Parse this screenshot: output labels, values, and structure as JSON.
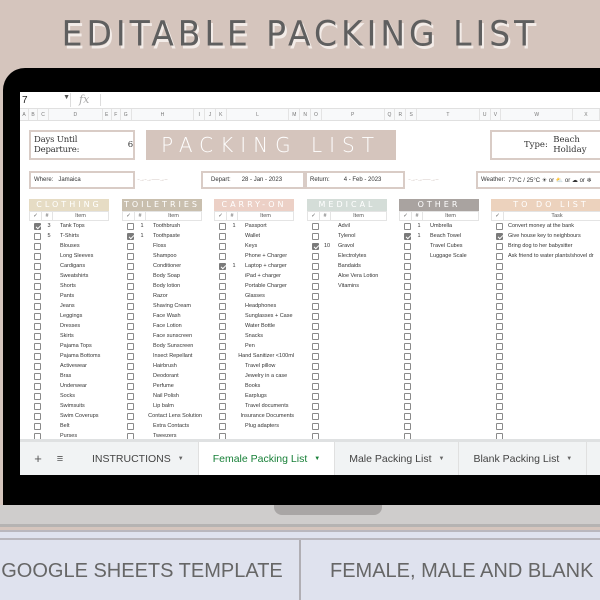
{
  "headline": "EDITABLE PACKING LIST",
  "formula_bar": {
    "cell_ref": "7",
    "fx_label": "fx"
  },
  "column_headers": [
    "A",
    "B",
    "C",
    "D",
    "E",
    "F",
    "G",
    "H",
    "I",
    "J",
    "K",
    "L",
    "M",
    "N",
    "O",
    "P",
    "Q",
    "R",
    "S",
    "T",
    "U",
    "V",
    "W",
    "X"
  ],
  "sheet": {
    "days_label": "Days Until Departure:",
    "days_value": "6",
    "title": "PACKING LIST",
    "type_label": "Type:",
    "type_value": "Beach Holiday",
    "where_label": "Where:",
    "where_value": "Jamaica",
    "depart_label": "Depart:",
    "depart_value": "28 - Jan - 2023",
    "return_label": "Return:",
    "return_value": "4 - Feb - 2023",
    "weather_label": "Weather:",
    "weather_value": "77°C / 25°C ☀ or ⛅ or ☁ or ❄",
    "arrow_decor": "··→··→········→···"
  },
  "categories": [
    {
      "name": "CLOTHING",
      "color": "#e6dcc4",
      "check_header": "✓",
      "qty_header": "#",
      "item_header": "Item",
      "items": [
        {
          "checked": true,
          "qty": "3",
          "item": "Tank Tops"
        },
        {
          "checked": false,
          "qty": "5",
          "item": "T-Shirts"
        },
        {
          "checked": false,
          "qty": "",
          "item": "Blouses"
        },
        {
          "checked": false,
          "qty": "",
          "item": "Long Sleeves"
        },
        {
          "checked": false,
          "qty": "",
          "item": "Cardigans"
        },
        {
          "checked": false,
          "qty": "",
          "item": "Sweatshirts"
        },
        {
          "checked": false,
          "qty": "",
          "item": "Shorts"
        },
        {
          "checked": false,
          "qty": "",
          "item": "Pants"
        },
        {
          "checked": false,
          "qty": "",
          "item": "Jeans"
        },
        {
          "checked": false,
          "qty": "",
          "item": "Leggings"
        },
        {
          "checked": false,
          "qty": "",
          "item": "Dresses"
        },
        {
          "checked": false,
          "qty": "",
          "item": "Skirts"
        },
        {
          "checked": false,
          "qty": "",
          "item": "Pajama Tops"
        },
        {
          "checked": false,
          "qty": "",
          "item": "Pajama Bottoms"
        },
        {
          "checked": false,
          "qty": "",
          "item": "Activewear"
        },
        {
          "checked": false,
          "qty": "",
          "item": "Bras"
        },
        {
          "checked": false,
          "qty": "",
          "item": "Underwear"
        },
        {
          "checked": false,
          "qty": "",
          "item": "Socks"
        },
        {
          "checked": false,
          "qty": "",
          "item": "Swimsuits"
        },
        {
          "checked": false,
          "qty": "",
          "item": "Swim Coverups"
        },
        {
          "checked": false,
          "qty": "",
          "item": "Belt"
        },
        {
          "checked": false,
          "qty": "",
          "item": "Purses"
        }
      ]
    },
    {
      "name": "TOILETRIES",
      "color": "#c9bfae",
      "check_header": "✓",
      "qty_header": "#",
      "item_header": "Item",
      "items": [
        {
          "checked": false,
          "qty": "1",
          "item": "Toothbrush"
        },
        {
          "checked": true,
          "qty": "1",
          "item": "Toothpaste"
        },
        {
          "checked": false,
          "qty": "",
          "item": "Floss"
        },
        {
          "checked": false,
          "qty": "",
          "item": "Shampoo"
        },
        {
          "checked": false,
          "qty": "",
          "item": "Conditioner"
        },
        {
          "checked": false,
          "qty": "",
          "item": "Body Soap"
        },
        {
          "checked": false,
          "qty": "",
          "item": "Body lotion"
        },
        {
          "checked": false,
          "qty": "",
          "item": "Razor"
        },
        {
          "checked": false,
          "qty": "",
          "item": "Shaving Cream"
        },
        {
          "checked": false,
          "qty": "",
          "item": "Face Wash"
        },
        {
          "checked": false,
          "qty": "",
          "item": "Face Lotion"
        },
        {
          "checked": false,
          "qty": "",
          "item": "Face sunscreen"
        },
        {
          "checked": false,
          "qty": "",
          "item": "Body Sunscreen"
        },
        {
          "checked": false,
          "qty": "",
          "item": "Insect Repellant"
        },
        {
          "checked": false,
          "qty": "",
          "item": "Hairbrush"
        },
        {
          "checked": false,
          "qty": "",
          "item": "Deodorant"
        },
        {
          "checked": false,
          "qty": "",
          "item": "Perfume"
        },
        {
          "checked": false,
          "qty": "",
          "item": "Nail Polish"
        },
        {
          "checked": false,
          "qty": "",
          "item": "Lip balm"
        },
        {
          "checked": false,
          "qty": "",
          "item": "Contact Lens Solution"
        },
        {
          "checked": false,
          "qty": "",
          "item": "Extra Contacts"
        },
        {
          "checked": false,
          "qty": "",
          "item": "Tweezers"
        }
      ]
    },
    {
      "name": "CARRY-ON",
      "color": "#ecd0c6",
      "check_header": "✓",
      "qty_header": "#",
      "item_header": "Item",
      "items": [
        {
          "checked": false,
          "qty": "1",
          "item": "Passport"
        },
        {
          "checked": false,
          "qty": "",
          "item": "Wallet"
        },
        {
          "checked": false,
          "qty": "",
          "item": "Keys"
        },
        {
          "checked": false,
          "qty": "",
          "item": "Phone + Charger"
        },
        {
          "checked": true,
          "qty": "1",
          "item": "Laptop + charger"
        },
        {
          "checked": false,
          "qty": "",
          "item": "iPad + charger"
        },
        {
          "checked": false,
          "qty": "",
          "item": "Portable Charger"
        },
        {
          "checked": false,
          "qty": "",
          "item": "Glasses"
        },
        {
          "checked": false,
          "qty": "",
          "item": "Headphones"
        },
        {
          "checked": false,
          "qty": "",
          "item": "Sunglasses + Case"
        },
        {
          "checked": false,
          "qty": "",
          "item": "Water Bottle"
        },
        {
          "checked": false,
          "qty": "",
          "item": "Snacks"
        },
        {
          "checked": false,
          "qty": "",
          "item": "Pen"
        },
        {
          "checked": false,
          "qty": "",
          "item": "Hand Sanitizer <100ml"
        },
        {
          "checked": false,
          "qty": "",
          "item": "Travel pillow"
        },
        {
          "checked": false,
          "qty": "",
          "item": "Jewelry in a case"
        },
        {
          "checked": false,
          "qty": "",
          "item": "Books"
        },
        {
          "checked": false,
          "qty": "",
          "item": "Earplugs"
        },
        {
          "checked": false,
          "qty": "",
          "item": "Travel documents"
        },
        {
          "checked": false,
          "qty": "",
          "item": "Insurance Documents"
        },
        {
          "checked": false,
          "qty": "",
          "item": "Plug adapters"
        },
        {
          "checked": false,
          "qty": "",
          "item": ""
        }
      ]
    },
    {
      "name": "MEDICAL",
      "color": "#d4ddd8",
      "check_header": "✓",
      "qty_header": "#",
      "item_header": "Item",
      "items": [
        {
          "checked": false,
          "qty": "",
          "item": "Advil"
        },
        {
          "checked": false,
          "qty": "",
          "item": "Tylenol"
        },
        {
          "checked": true,
          "qty": "10",
          "item": "Gravol"
        },
        {
          "checked": false,
          "qty": "",
          "item": "Electrolytes"
        },
        {
          "checked": false,
          "qty": "",
          "item": "Bandaids"
        },
        {
          "checked": false,
          "qty": "",
          "item": "Aloe Vera Lotion"
        },
        {
          "checked": false,
          "qty": "",
          "item": "Vitamins"
        },
        {
          "checked": false,
          "qty": "",
          "item": ""
        },
        {
          "checked": false,
          "qty": "",
          "item": ""
        },
        {
          "checked": false,
          "qty": "",
          "item": ""
        },
        {
          "checked": false,
          "qty": "",
          "item": ""
        },
        {
          "checked": false,
          "qty": "",
          "item": ""
        },
        {
          "checked": false,
          "qty": "",
          "item": ""
        },
        {
          "checked": false,
          "qty": "",
          "item": ""
        },
        {
          "checked": false,
          "qty": "",
          "item": ""
        },
        {
          "checked": false,
          "qty": "",
          "item": ""
        },
        {
          "checked": false,
          "qty": "",
          "item": ""
        },
        {
          "checked": false,
          "qty": "",
          "item": ""
        },
        {
          "checked": false,
          "qty": "",
          "item": ""
        },
        {
          "checked": false,
          "qty": "",
          "item": ""
        },
        {
          "checked": false,
          "qty": "",
          "item": ""
        },
        {
          "checked": false,
          "qty": "",
          "item": ""
        }
      ]
    },
    {
      "name": "OTHER",
      "color": "#a9a3a0",
      "check_header": "✓",
      "qty_header": "#",
      "item_header": "Item",
      "items": [
        {
          "checked": false,
          "qty": "1",
          "item": "Umbrella"
        },
        {
          "checked": true,
          "qty": "1",
          "item": "Beach Towel"
        },
        {
          "checked": false,
          "qty": "",
          "item": "Travel Cubes"
        },
        {
          "checked": false,
          "qty": "",
          "item": "Luggage Scale"
        },
        {
          "checked": false,
          "qty": "",
          "item": ""
        },
        {
          "checked": false,
          "qty": "",
          "item": ""
        },
        {
          "checked": false,
          "qty": "",
          "item": ""
        },
        {
          "checked": false,
          "qty": "",
          "item": ""
        },
        {
          "checked": false,
          "qty": "",
          "item": ""
        },
        {
          "checked": false,
          "qty": "",
          "item": ""
        },
        {
          "checked": false,
          "qty": "",
          "item": ""
        },
        {
          "checked": false,
          "qty": "",
          "item": ""
        },
        {
          "checked": false,
          "qty": "",
          "item": ""
        },
        {
          "checked": false,
          "qty": "",
          "item": ""
        },
        {
          "checked": false,
          "qty": "",
          "item": ""
        },
        {
          "checked": false,
          "qty": "",
          "item": ""
        },
        {
          "checked": false,
          "qty": "",
          "item": ""
        },
        {
          "checked": false,
          "qty": "",
          "item": ""
        },
        {
          "checked": false,
          "qty": "",
          "item": ""
        },
        {
          "checked": false,
          "qty": "",
          "item": ""
        },
        {
          "checked": false,
          "qty": "",
          "item": ""
        },
        {
          "checked": false,
          "qty": "",
          "item": ""
        }
      ]
    },
    {
      "name": "TO DO LIST",
      "color": "#ecd2bd",
      "todo": true,
      "check_header": "✓",
      "item_header": "Task",
      "items": [
        {
          "checked": false,
          "item": "Convert money at the bank"
        },
        {
          "checked": true,
          "item": "Give house key to neighbours"
        },
        {
          "checked": false,
          "item": "Bring dog to her babysitter"
        },
        {
          "checked": false,
          "item": "Ask friend to water plants/shovel dr"
        },
        {
          "checked": false,
          "item": ""
        },
        {
          "checked": false,
          "item": ""
        },
        {
          "checked": false,
          "item": ""
        },
        {
          "checked": false,
          "item": ""
        },
        {
          "checked": false,
          "item": ""
        },
        {
          "checked": false,
          "item": ""
        },
        {
          "checked": false,
          "item": ""
        },
        {
          "checked": false,
          "item": ""
        },
        {
          "checked": false,
          "item": ""
        },
        {
          "checked": false,
          "item": ""
        },
        {
          "checked": false,
          "item": ""
        },
        {
          "checked": false,
          "item": ""
        },
        {
          "checked": false,
          "item": ""
        },
        {
          "checked": false,
          "item": ""
        },
        {
          "checked": false,
          "item": ""
        },
        {
          "checked": false,
          "item": ""
        },
        {
          "checked": false,
          "item": ""
        },
        {
          "checked": false,
          "item": ""
        }
      ]
    }
  ],
  "sheet_tabs": {
    "add_icon": "+",
    "menu_icon": "≡",
    "tabs": [
      {
        "label": "INSTRUCTIONS",
        "active": false
      },
      {
        "label": "Female Packing List",
        "active": true
      },
      {
        "label": "Male Packing List",
        "active": false
      },
      {
        "label": "Blank Packing List",
        "active": false
      }
    ],
    "dropdown_icon": "▼"
  },
  "banner": {
    "left": "GOOGLE SHEETS TEMPLATE",
    "right": "FEMALE, MALE AND BLANK"
  }
}
